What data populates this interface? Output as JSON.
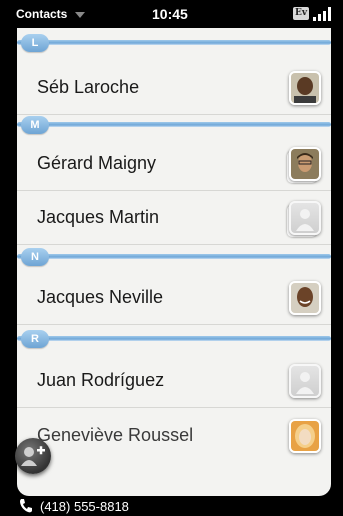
{
  "status_bar": {
    "app_name": "Contacts",
    "time": "10:45",
    "network_badge": "Ev",
    "icons": [
      "chevron-down-icon",
      "signal-strength-icon"
    ]
  },
  "contact_list": {
    "sections": [
      {
        "letter": "L",
        "contacts": [
          {
            "name": "Séb Laroche",
            "avatar": "photo",
            "avatar_icon": "person-photo-icon"
          }
        ]
      },
      {
        "letter": "M",
        "contacts": [
          {
            "name": "Gérard Maigny",
            "avatar": "photo-stack",
            "avatar_icon": "person-photo-icon"
          },
          {
            "name": "Jacques Martin",
            "avatar": "placeholder-stack",
            "avatar_icon": "person-placeholder-icon"
          }
        ]
      },
      {
        "letter": "N",
        "contacts": [
          {
            "name": "Jacques Neville",
            "avatar": "photo",
            "avatar_icon": "person-photo-icon"
          }
        ]
      },
      {
        "letter": "R",
        "contacts": [
          {
            "name": "Juan Rodríguez",
            "avatar": "placeholder",
            "avatar_icon": "person-placeholder-icon"
          },
          {
            "name": "Geneviève Roussel",
            "avatar": "photo",
            "avatar_icon": "person-photo-icon"
          }
        ]
      }
    ]
  },
  "add_contact_button": {
    "icon": "add-contact-icon"
  },
  "bottom_bar": {
    "phone_number": "(418) 555-8818",
    "icon": "phone-icon"
  },
  "colors": {
    "divider_blue": "#6fa7d8",
    "list_background": "#f3f3f1",
    "status_background": "#000000"
  }
}
